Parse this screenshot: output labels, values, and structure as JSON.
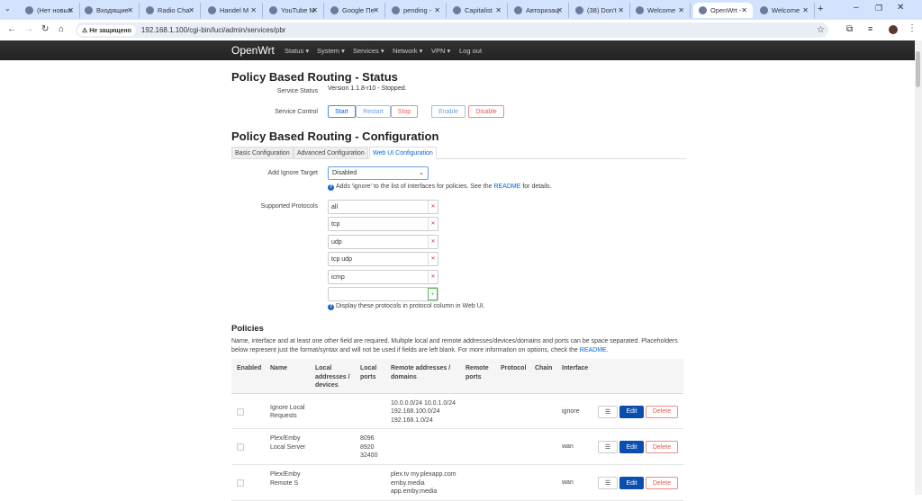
{
  "browser": {
    "tabs": [
      {
        "label": "(Нет новых"
      },
      {
        "label": "Входящие"
      },
      {
        "label": "Radio Cha"
      },
      {
        "label": "Handel M"
      },
      {
        "label": "YouTube M"
      },
      {
        "label": "Google Пе"
      },
      {
        "label": "pending -"
      },
      {
        "label": "Capitalist"
      },
      {
        "label": "Авторизац"
      },
      {
        "label": "(38) Don't"
      },
      {
        "label": "Welcome"
      },
      {
        "label": "OpenWrt -",
        "active": true
      },
      {
        "label": "Welcome"
      }
    ],
    "security_label": "Не защищено",
    "url": "192.168.1.100/cgi-bin/luci/admin/services/pbr"
  },
  "nav": {
    "brand": "OpenWrt",
    "items": [
      "Status ▾",
      "System ▾",
      "Services ▾",
      "Network ▾",
      "VPN ▾",
      "Log out"
    ]
  },
  "status": {
    "title": "Policy Based Routing - Status",
    "service_status_label": "Service Status",
    "service_status_value": "Version 1.1.8-r10 - Stopped.",
    "service_control_label": "Service Control",
    "buttons": {
      "start": "Start",
      "restart": "Restart",
      "stop": "Stop",
      "enable": "Enable",
      "disable": "Disable"
    }
  },
  "config": {
    "title": "Policy Based Routing - Configuration",
    "tabs": [
      "Basic Configuration",
      "Advanced Configuration",
      "Web UI Configuration"
    ],
    "active_tab": "Web UI Configuration",
    "ignore_label": "Add Ignore Target",
    "ignore_value": "Disabled",
    "ignore_help_pre": "Adds 'ignore' to the list of interfaces for policies. See the ",
    "ignore_help_link": "README",
    "ignore_help_post": " for details.",
    "protocols_label": "Supported Protocols",
    "protocols": [
      "all",
      "tcp",
      "udp",
      "tcp udp",
      "icmp"
    ],
    "protocols_new": "",
    "protocols_help": "Display these protocols in protocol column in Web UI."
  },
  "policies": {
    "title": "Policies",
    "desc": "Name, interface and at least one other field are required. Multiple local and remote addresses/devices/domains and ports can be space separated. Placeholders below represent just the format/syntax and will not be used if fields are left blank. For more information on options, check the ",
    "desc_link": "README",
    "desc_end": ".",
    "headers": [
      "Enabled",
      "Name",
      "Local addresses / devices",
      "Local ports",
      "Remote addresses / domains",
      "Remote ports",
      "Protocol",
      "Chain",
      "Interface"
    ],
    "rows": [
      {
        "enabled": false,
        "name": "Ignore Local Requests",
        "local_ports": "",
        "remote": "10.0.0.0/24 10.0.1.0/24 192.168.100.0/24 192.168.1.0/24",
        "interface": "ignore"
      },
      {
        "enabled": false,
        "name": "Plex/Emby Local Server",
        "local_ports": "8096 8920 32400",
        "remote": "",
        "interface": "wan"
      },
      {
        "enabled": false,
        "name": "Plex/Emby Remote S",
        "local_ports": "",
        "remote": "plex.tv my.plexapp.com emby.media app.emby.media",
        "interface": "wan"
      }
    ],
    "menu_label": "☰",
    "edit_label": "Edit",
    "delete_label": "Delete"
  }
}
